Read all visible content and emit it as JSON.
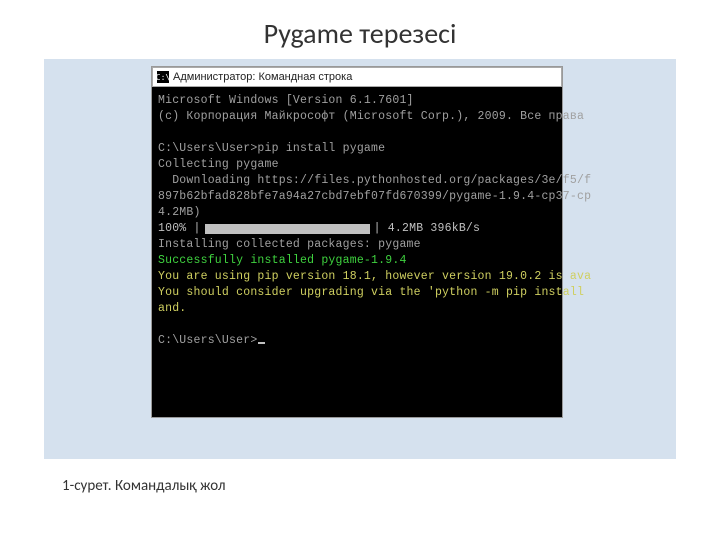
{
  "slide": {
    "title": "Pygame терезесі",
    "caption": "1-сурет. Командалық жол"
  },
  "window": {
    "icon_label": "C:\\",
    "title": "Администратор: Командная строка"
  },
  "console": {
    "line1": "Microsoft Windows [Version 6.1.7601]",
    "line2": "(c) Корпорация Майкрософт (Microsoft Corp.), 2009. Все права",
    "blank1": " ",
    "line3": "C:\\Users\\User>pip install pygame",
    "line4": "Collecting pygame",
    "line5_a": "  Downloading https://files.pythonhosted.org/packages/3e/f5/f",
    "line5_b": "897b62bfad828bfe7a94a27cbd7ebf07fd670399/pygame-1.9.4-cp37-cp",
    "line5_c": "4.2MB)",
    "progress_pct": "   100% |",
    "progress_tail": "| 4.2MB 396kB/s",
    "line6": "Installing collected packages: pygame",
    "line7": "Successfully installed pygame-1.9.4",
    "line8_a": "You are using pip version 18.1, however version 19.0.2 is ava",
    "line8_b": "You should consider upgrading via the 'python -m pip install ",
    "line8_c": "and.",
    "blank2": " ",
    "prompt": "C:\\Users\\User>"
  }
}
